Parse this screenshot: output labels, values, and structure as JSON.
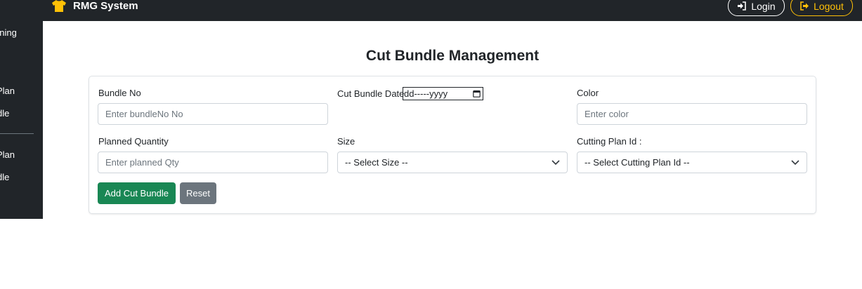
{
  "navbar": {
    "brand": "RMG System",
    "brand_icon": "shirt-icon",
    "login_label": "Login",
    "logout_label": "Logout"
  },
  "sidebar": {
    "items": [
      {
        "label": "nning"
      },
      {
        "label": "Plan"
      },
      {
        "label": "dle"
      },
      {
        "label": "Plan"
      },
      {
        "label": "dle"
      }
    ]
  },
  "page": {
    "title": "Cut Bundle Management"
  },
  "form": {
    "bundle_no": {
      "label": "Bundle No",
      "placeholder": "Enter bundleNo No"
    },
    "cut_bundle_date": {
      "label": "Cut Bundle Date",
      "value": "dd-----yyyy"
    },
    "color": {
      "label": "Color",
      "placeholder": "Enter color"
    },
    "planned_quantity": {
      "label": "Planned Quantity",
      "placeholder": "Enter planned Qty"
    },
    "size": {
      "label": "Size",
      "selected": "-- Select Size --"
    },
    "cutting_plan_id": {
      "label": "Cutting Plan Id :",
      "selected": "-- Select Cutting Plan Id --"
    },
    "add_button": "Add Cut Bundle",
    "reset_button": "Reset"
  },
  "colors": {
    "navbar_bg": "#212529",
    "success": "#198754",
    "secondary": "#6c757d",
    "warning": "#ffc107"
  }
}
